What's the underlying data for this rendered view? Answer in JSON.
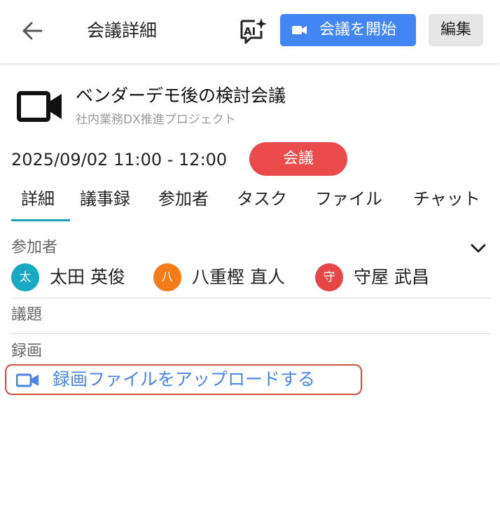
{
  "header": {
    "back_icon": "arrow-left-icon",
    "title": "会議詳細",
    "ai_icon": "ai-sparkle-icon",
    "start_button": {
      "icon": "video-camera-icon",
      "label": "会議を開始"
    },
    "edit_label": "編集"
  },
  "meeting": {
    "icon": "video-camera-icon",
    "title": "ベンダーデモ後の検討会議",
    "project": "社内業務DX推進プロジェクト",
    "datetime": "2025/09/02 11:00 - 12:00",
    "type_badge": "会議"
  },
  "tabs": [
    {
      "label": "詳細",
      "active": true
    },
    {
      "label": "議事録"
    },
    {
      "label": "参加者"
    },
    {
      "label": "タスク"
    },
    {
      "label": "ファイル"
    },
    {
      "label": "チャット"
    }
  ],
  "participants": {
    "label": "参加者",
    "expand_icon": "chevron-down-icon",
    "people": [
      {
        "initial": "太",
        "name": "太田 英俊",
        "color": "#17a9c4"
      },
      {
        "initial": "八",
        "name": "八重樫 直人",
        "color": "#f57b17"
      },
      {
        "initial": "守",
        "name": "守屋 武昌",
        "color": "#e74646"
      }
    ]
  },
  "agenda": {
    "label": "議題"
  },
  "recording": {
    "label": "録画",
    "upload_icon": "video-camera-icon",
    "upload_label": "録画ファイルをアップロードする"
  },
  "colors": {
    "primary_button": "#4285f4",
    "badge": "#ea4a4a",
    "tab_underline": "#1aa0b0",
    "link": "#4a86e8",
    "highlight_border": "#d24e42"
  }
}
